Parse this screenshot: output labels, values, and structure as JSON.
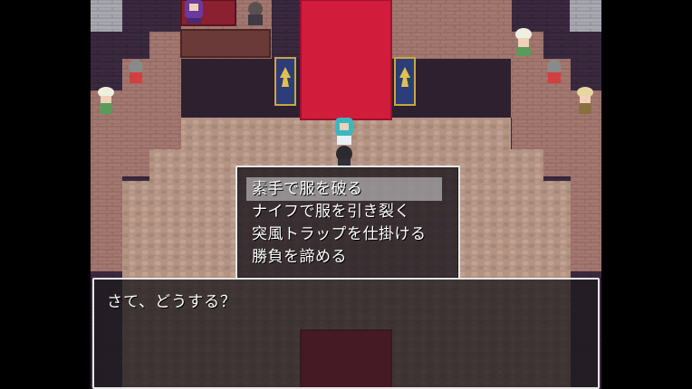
{
  "choices": [
    {
      "label": "素手で服を破る",
      "selected": true
    },
    {
      "label": "ナイフで服を引き裂く",
      "selected": false
    },
    {
      "label": "突風トラップを仕掛ける",
      "selected": false
    },
    {
      "label": "勝負を諦める",
      "selected": false
    }
  ],
  "message": {
    "text": "さて、どうする？"
  },
  "colors": {
    "carpet": "#d21c3c",
    "cobblestone": "#b39383",
    "brick": "#a37870",
    "dark_wall": "#3b2a3f",
    "banner": "#2c3d7a"
  },
  "scene": {
    "banner_icon": "winged-crest-icon",
    "npcs": [
      "purple-haired-girl-on-throne",
      "dark-haired-guard",
      "white-turban-villager",
      "gray-haired-villager",
      "teal-haired-girl",
      "black-haired-player"
    ]
  }
}
